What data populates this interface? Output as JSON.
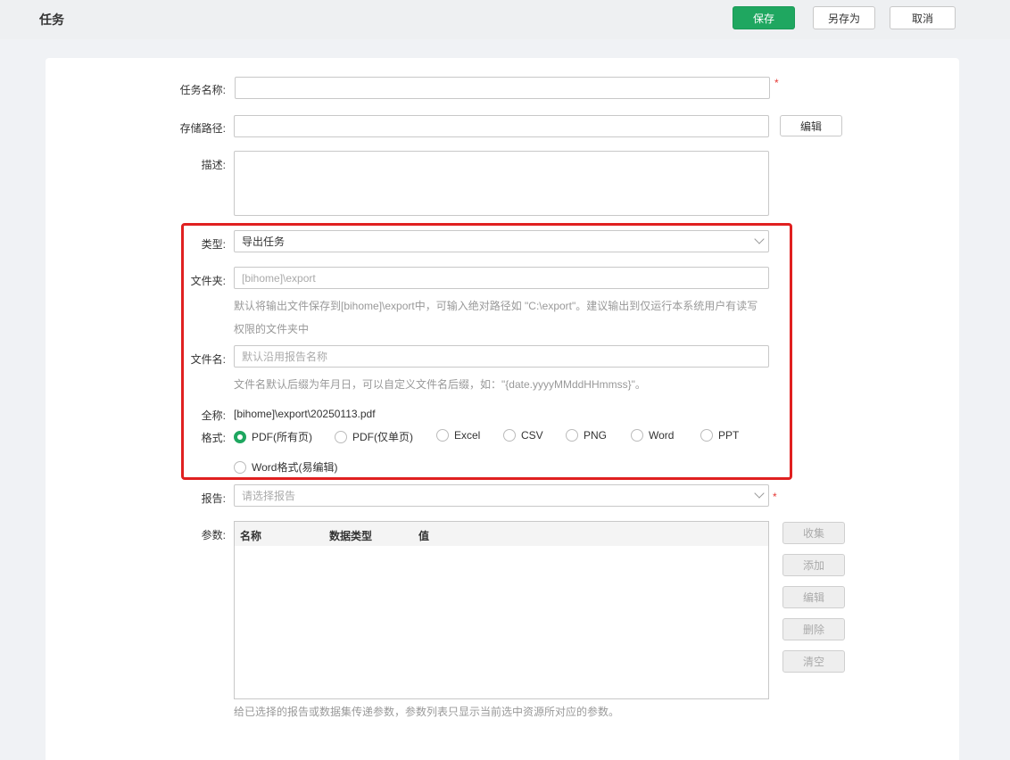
{
  "header": {
    "title": "任务",
    "save_label": "保存",
    "save_as_label": "另存为",
    "cancel_label": "取消"
  },
  "form": {
    "task_name": {
      "label": "任务名称:",
      "value": "",
      "required": "*"
    },
    "storage_path": {
      "label": "存储路径:",
      "value": "",
      "edit_label": "编辑"
    },
    "description": {
      "label": "描述:",
      "value": ""
    },
    "type": {
      "label": "类型:",
      "value": "导出任务"
    },
    "folder": {
      "label": "文件夹:",
      "placeholder": "[bihome]\\export",
      "hint_line1": "默认将输出文件保存到[bihome]\\export中，可输入绝对路径如 \"C:\\export\"。建议输出到仅运行本系统用户有读写",
      "hint_line2": "权限的文件夹中"
    },
    "filename": {
      "label": "文件名:",
      "placeholder": "默认沿用报告名称",
      "hint": "文件名默认后缀为年月日，可以自定义文件名后缀，如：\"{date.yyyyMMddHHmmss}\"。"
    },
    "fullname": {
      "label": "全称:",
      "value": "[bihome]\\export\\20250113.pdf"
    },
    "format": {
      "label": "格式:",
      "options": [
        "PDF(所有页)",
        "PDF(仅单页)",
        "Excel",
        "CSV",
        "PNG",
        "Word",
        "PPT",
        "Word格式(易编辑)"
      ],
      "selected": "PDF(所有页)"
    },
    "report": {
      "label": "报告:",
      "placeholder": "请选择报告",
      "required": "*"
    },
    "params": {
      "label": "参数:",
      "columns": [
        "名称",
        "数据类型",
        "值"
      ],
      "rows": [],
      "buttons": {
        "collect": "收集",
        "add": "添加",
        "edit": "编辑",
        "delete": "删除",
        "clear": "清空"
      },
      "hint": "给已选择的报告或数据集传递参数，参数列表只显示当前选中资源所对应的参数。"
    }
  },
  "colors": {
    "accent": "#1fa760",
    "highlight": "#e02020",
    "required": "#e53935"
  }
}
